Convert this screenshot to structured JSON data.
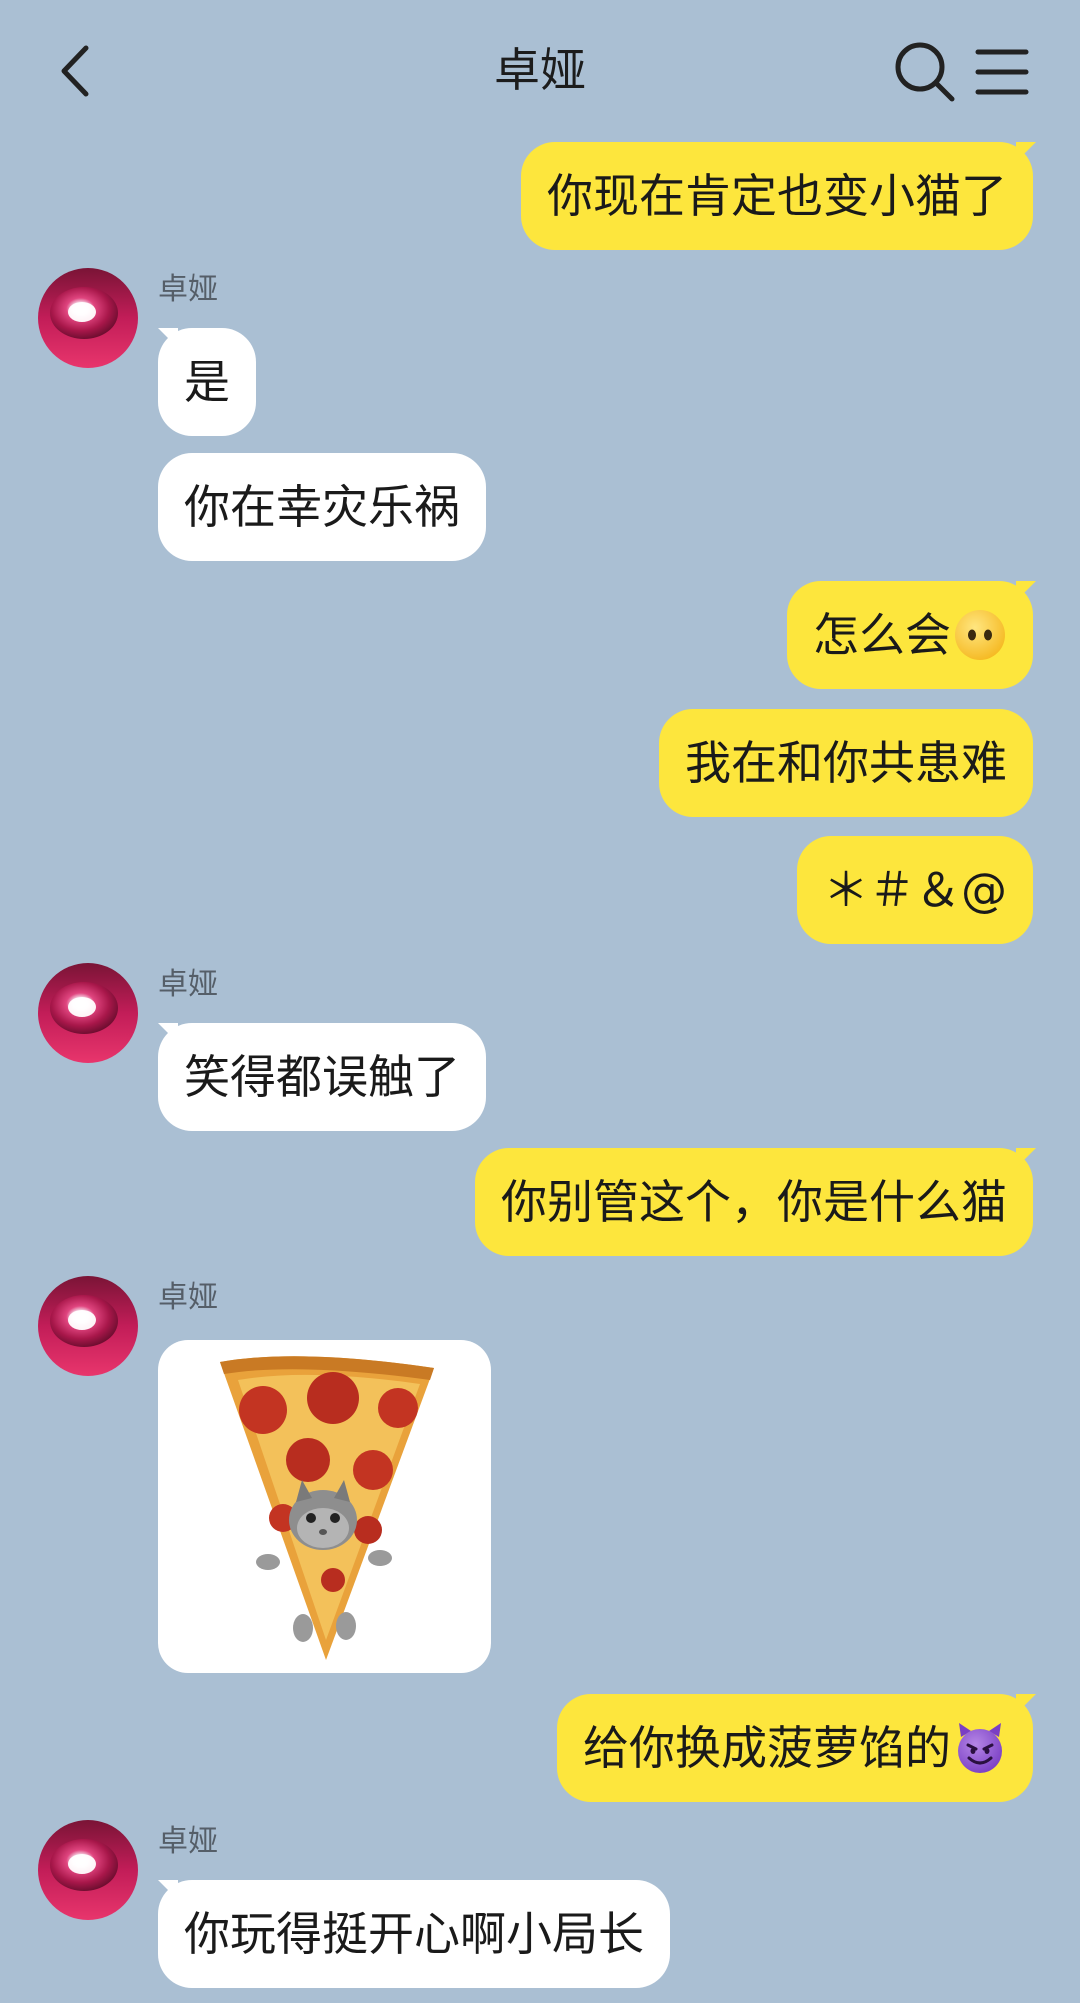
{
  "header": {
    "title": "卓娅",
    "back_icon": "chevron-left-icon",
    "search_icon": "search-icon",
    "menu_icon": "menu-icon"
  },
  "contact": {
    "name": "卓娅"
  },
  "messages": [
    {
      "from": "me",
      "text": "你现在肯定也变小猫了"
    },
    {
      "from": "contact",
      "text": "是"
    },
    {
      "from": "contact",
      "text": "你在幸灾乐祸"
    },
    {
      "from": "me",
      "text": "怎么会",
      "emoji": "neutral-face-emoji"
    },
    {
      "from": "me",
      "text": "我在和你共患难"
    },
    {
      "from": "me",
      "text": "＊＃＆@"
    },
    {
      "from": "contact",
      "text": "笑得都误触了"
    },
    {
      "from": "me",
      "text": "你别管这个，你是什么猫"
    },
    {
      "from": "contact",
      "sticker": "pizza-cat-sticker"
    },
    {
      "from": "me",
      "text": "给你换成菠萝馅的",
      "emoji": "smiling-devil-emoji"
    },
    {
      "from": "contact",
      "text": "你玩得挺开心啊小局长"
    }
  ],
  "colors": {
    "background": "#aabfd3",
    "outgoing_bubble": "#fde63d",
    "incoming_bubble": "#ffffff"
  }
}
